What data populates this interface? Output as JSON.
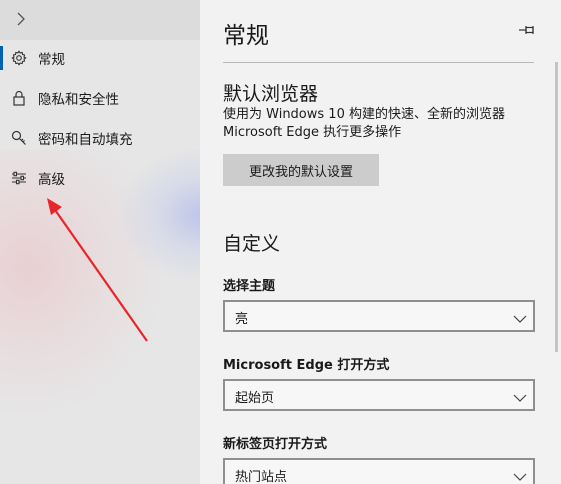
{
  "nav": {
    "toggle_glyph": "›",
    "items": [
      {
        "label": "常规",
        "icon": "gear-icon",
        "selected": true
      },
      {
        "label": "隐私和安全性",
        "icon": "lock-icon",
        "selected": false
      },
      {
        "label": "密码和自动填充",
        "icon": "key-icon",
        "selected": false
      },
      {
        "label": "高级",
        "icon": "sliders-icon",
        "selected": false
      }
    ]
  },
  "main": {
    "title": "常规",
    "default_browser": {
      "heading": "默认浏览器",
      "description_line1": "使用为 Windows 10 构建的快速、全新的浏览器",
      "description_line2": "Microsoft Edge 执行更多操作",
      "button_label": "更改我的默认设置"
    },
    "customize": {
      "heading": "自定义",
      "theme": {
        "label": "选择主题",
        "value": "亮"
      },
      "open_with": {
        "label": "Microsoft Edge 打开方式",
        "value": "起始页"
      },
      "new_tab": {
        "label": "新标签页打开方式",
        "value": "热门站点"
      }
    }
  },
  "colors": {
    "accent": "#0063b1",
    "annotation_arrow": "#e8262a"
  }
}
